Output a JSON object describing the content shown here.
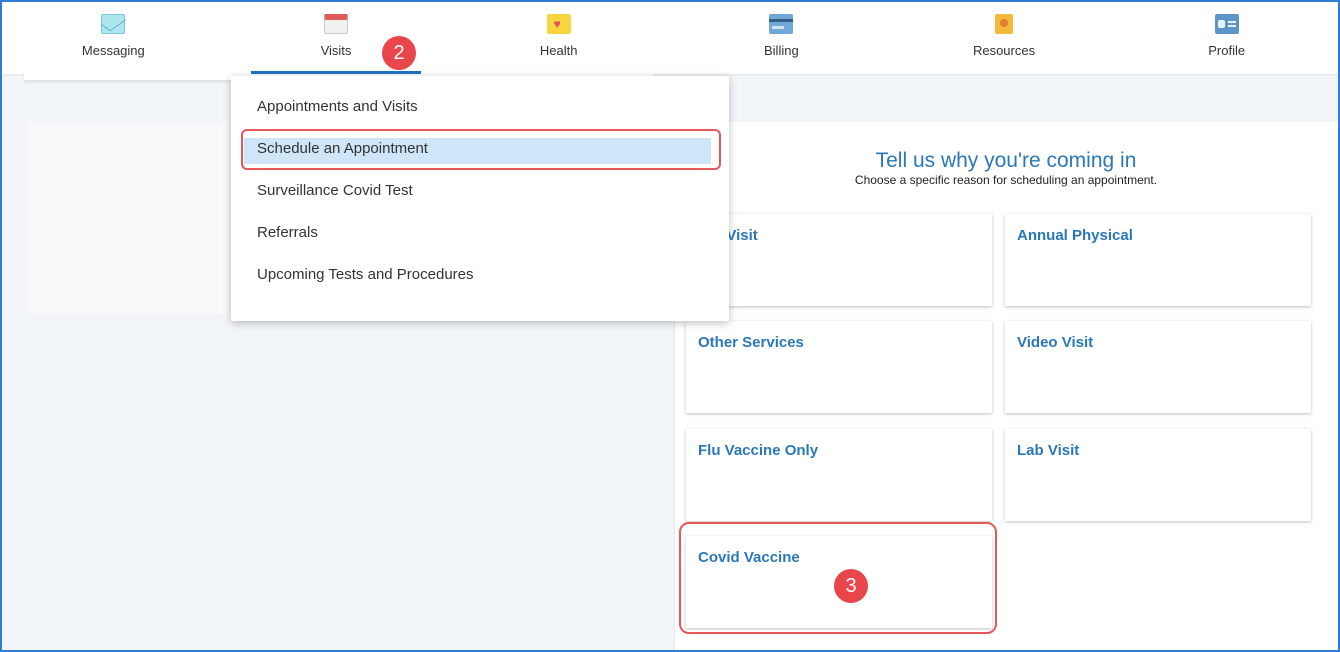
{
  "nav": {
    "items": [
      {
        "label": "Messaging"
      },
      {
        "label": "Visits"
      },
      {
        "label": "Health"
      },
      {
        "label": "Billing"
      },
      {
        "label": "Resources"
      },
      {
        "label": "Profile"
      }
    ],
    "active": "Visits"
  },
  "dropdown": {
    "items": [
      {
        "label": "Appointments and Visits"
      },
      {
        "label": "Schedule an Appointment"
      },
      {
        "label": "Surveillance Covid Test"
      },
      {
        "label": "Referrals"
      },
      {
        "label": "Upcoming Tests and Procedures"
      }
    ],
    "selected": "Schedule an Appointment"
  },
  "main": {
    "heading": "Tell us why you're coming in",
    "subheading": "Choose a specific reason for scheduling an appointment.",
    "reasons": [
      {
        "label": "Return Visit",
        "visible_label": "urn Visit"
      },
      {
        "label": "Annual Physical"
      },
      {
        "label": "Other Services"
      },
      {
        "label": "Video Visit"
      },
      {
        "label": "Flu Vaccine Only"
      },
      {
        "label": "Lab Visit"
      },
      {
        "label": "Covid Vaccine"
      }
    ]
  },
  "annotations": {
    "step2": "2",
    "step3": "3"
  },
  "colors": {
    "accent": "#2b78b8",
    "highlight": "#cfe6f8",
    "callout": "#e8464a",
    "frame": "#2f7bd6"
  }
}
